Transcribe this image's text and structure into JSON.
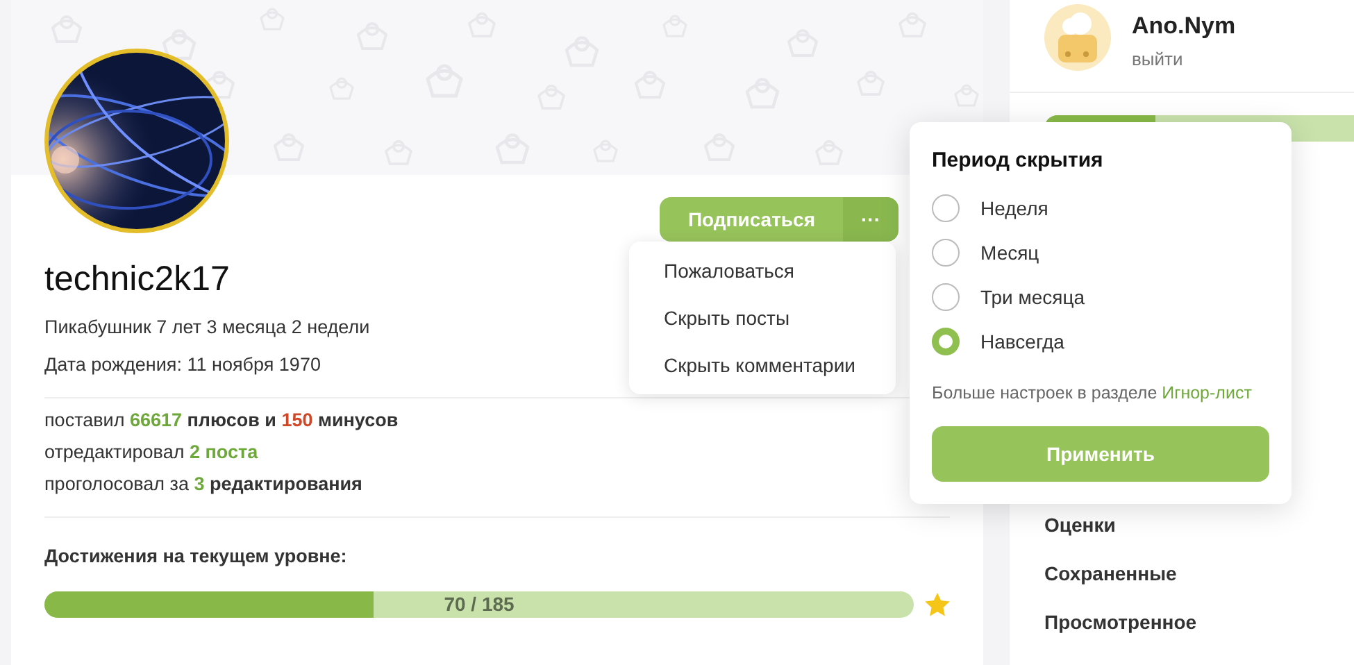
{
  "profile": {
    "username": "technic2k17",
    "tenure": "Пикабушник 7 лет 3 месяца 2 недели",
    "birthday": "Дата рождения: 11 ноября 1970",
    "actions": {
      "subscribe": "Подписаться",
      "more": "···"
    },
    "stats": [
      [
        {
          "text": "поставил ",
          "kind": "plain"
        },
        {
          "text": "66617",
          "kind": "plus"
        },
        {
          "text": " плюсов и ",
          "kind": "bold"
        },
        {
          "text": "150",
          "kind": "minus"
        },
        {
          "text": " минусов",
          "kind": "bold"
        }
      ],
      [
        {
          "text": "отредактировал ",
          "kind": "plain"
        },
        {
          "text": "2 поста",
          "kind": "plus"
        }
      ],
      [
        {
          "text": "проголосовал за ",
          "kind": "plain"
        },
        {
          "text": "3",
          "kind": "plus"
        },
        {
          "text": " редактирования",
          "kind": "bold"
        }
      ]
    ],
    "achievements": {
      "title": "Достижения на текущем уровне:",
      "level": 0.378,
      "reading": "70 / 185"
    }
  },
  "menu": {
    "items": [
      "Пожаловаться",
      "Скрыть посты",
      "Скрыть комментарии"
    ]
  },
  "hide_period": {
    "title": "Период скрытия",
    "options": [
      {
        "label": "Неделя",
        "selected": false
      },
      {
        "label": "Месяц",
        "selected": false
      },
      {
        "label": "Три месяца",
        "selected": false
      },
      {
        "label": "Навсегда",
        "selected": true
      }
    ],
    "hint": "Больше настроек в разделе ",
    "hint_link": "Игнор-лист",
    "apply": "Применить"
  },
  "sidebar": {
    "user": {
      "name": "Ano.Nym",
      "logout": "выйти"
    },
    "rating": {
      "level": 0.36
    },
    "items": [
      "Оценки",
      "Сохраненные",
      "Просмотренное"
    ]
  }
}
